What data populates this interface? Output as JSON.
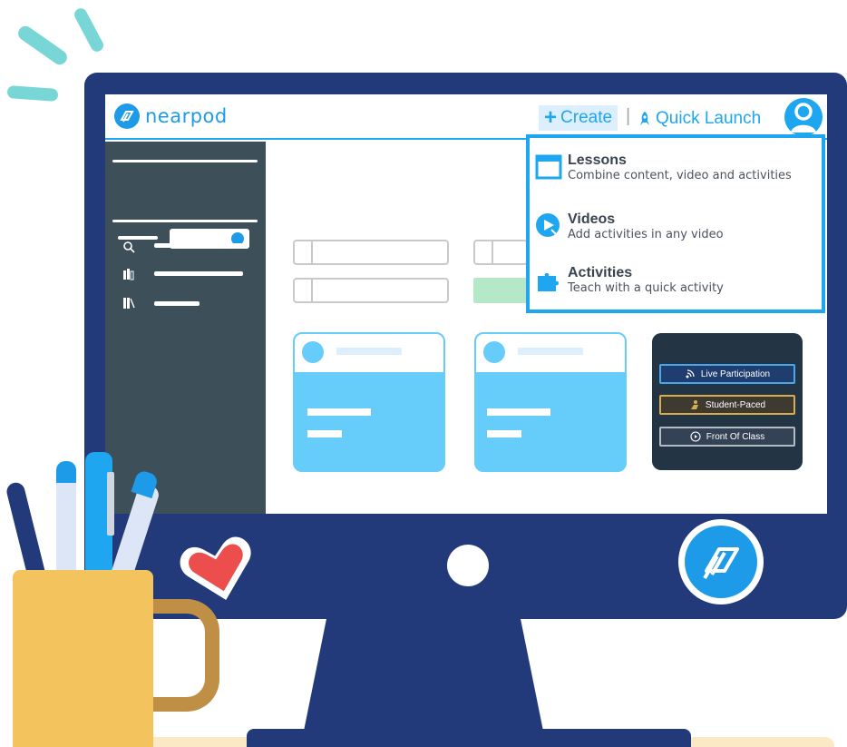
{
  "app": {
    "logo_text": "nearpod",
    "brand_color": "#1ea6f0"
  },
  "topbar": {
    "create_label": "Create",
    "separator": "|",
    "quick_launch_label": "Quick Launch"
  },
  "create_menu": {
    "items": [
      {
        "icon": "lesson-window-icon",
        "title": "Lessons",
        "description": "Combine content, video and activities"
      },
      {
        "icon": "video-play-icon",
        "title": "Videos",
        "description": "Add activities in any video"
      },
      {
        "icon": "puzzle-piece-icon",
        "title": "Activities",
        "description": "Teach with a quick activity"
      }
    ]
  },
  "sidebar": {
    "icons": [
      "search-icon",
      "library-icon",
      "books-icon"
    ]
  },
  "launch_modes": {
    "live_label": "Live Participation",
    "student_label": "Student-Paced",
    "front_label": "Front Of Class"
  }
}
